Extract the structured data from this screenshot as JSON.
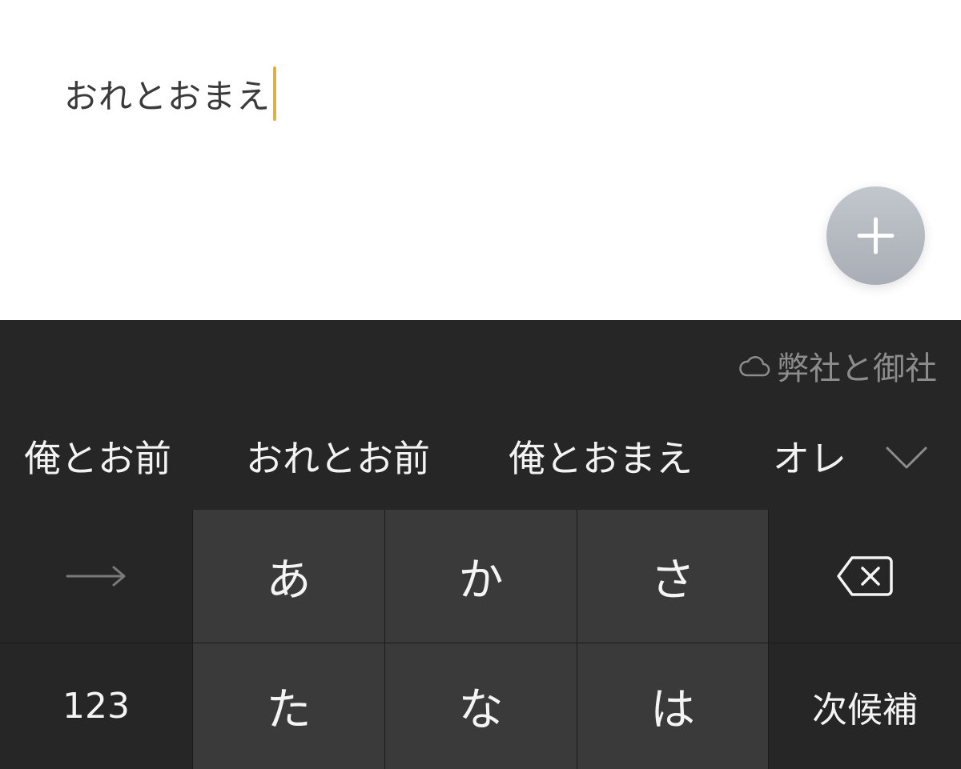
{
  "editor": {
    "text": "おれとおまえ"
  },
  "keyboard": {
    "cloud_suggestion": "弊社と御社",
    "candidates": [
      "俺とお前",
      "おれとお前",
      "俺とおまえ",
      "オレ"
    ],
    "keys": {
      "row1": [
        "あ",
        "か",
        "さ"
      ],
      "row2": [
        "た",
        "な",
        "は"
      ],
      "numbers_label": "123",
      "next_candidate_label": "次候補"
    }
  },
  "icons": {
    "fab": "plus-icon",
    "cloud": "cloud-icon",
    "expand": "chevron-down-icon",
    "arrow": "arrow-right-icon",
    "backspace": "backspace-icon"
  },
  "colors": {
    "caret": "#e2b13c",
    "keyboard_bg": "#262626",
    "key_bg": "#3a3a3a",
    "fab": "#b5bac2"
  }
}
